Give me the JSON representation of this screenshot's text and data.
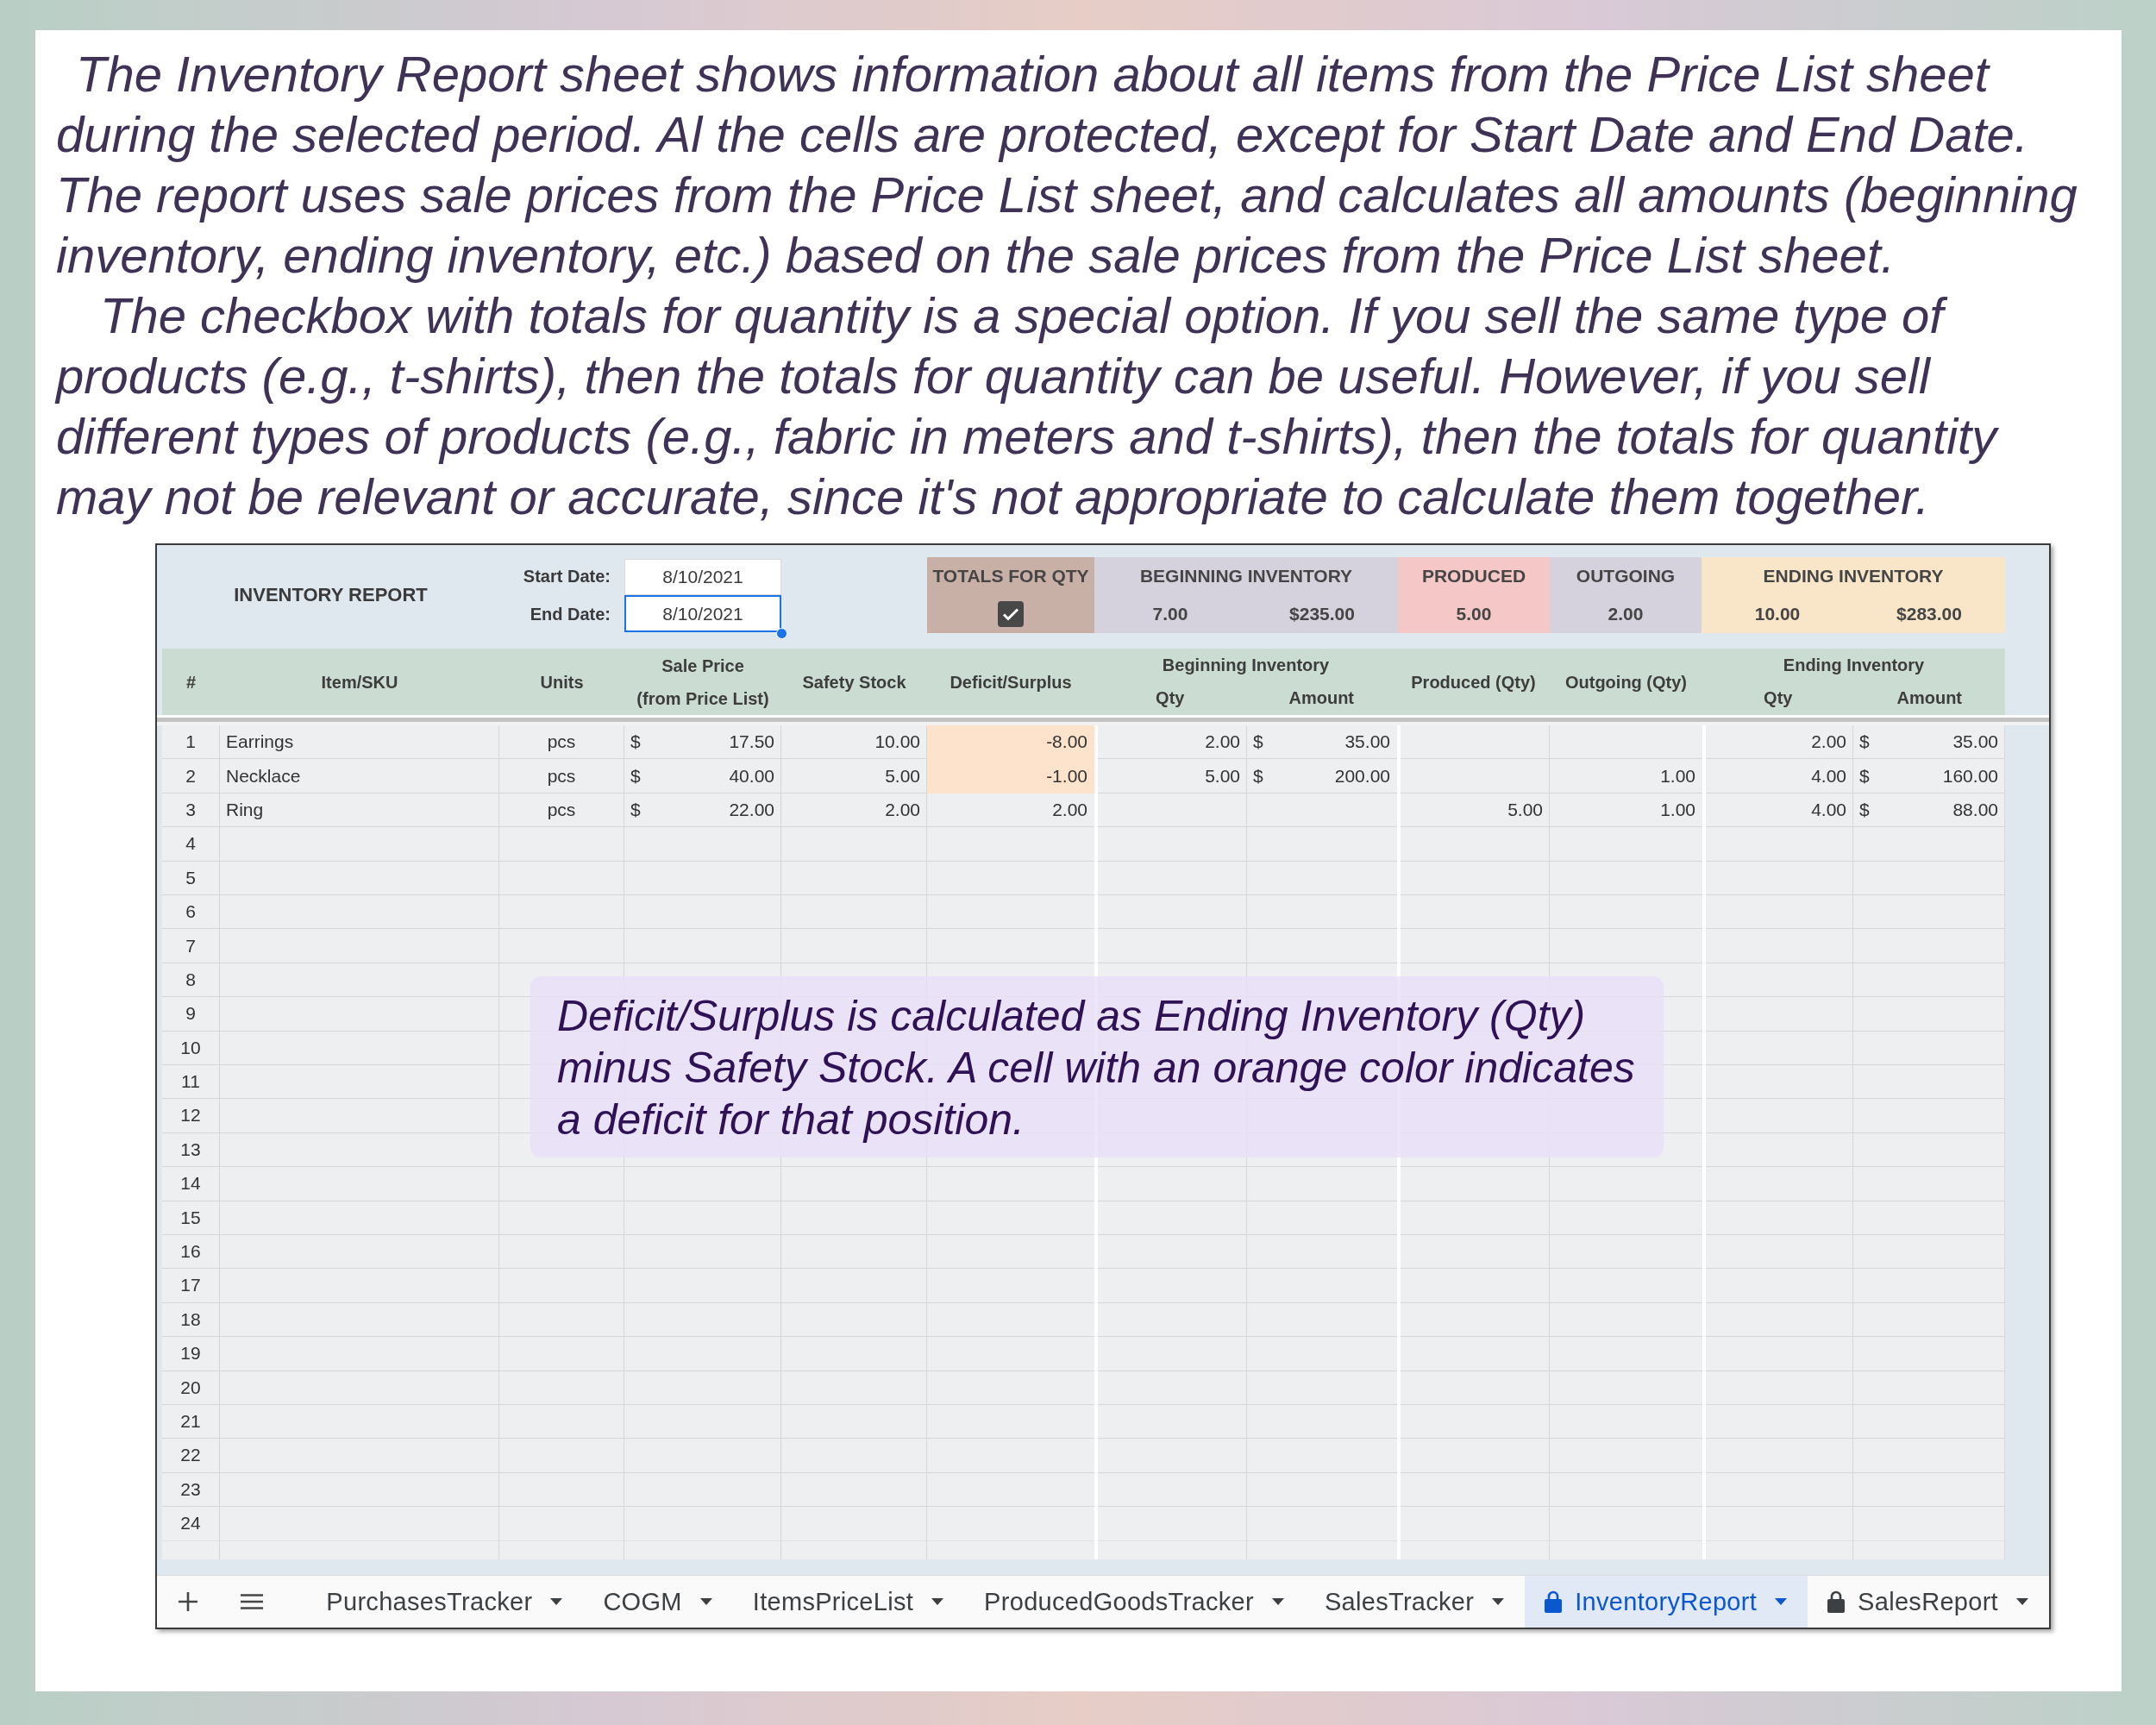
{
  "intro": {
    "paragraphs": [
      "The Inventory Report sheet shows information about all items from the Price List sheet during the selected period. Al the cells are protected, except for Start Date and End Date. The report uses sale prices from the Price List sheet, and calculates all amounts (beginning inventory, ending inventory, etc.) based on the sale prices from the Price List sheet.",
      "The checkbox with totals for quantity is a special option. If you sell the same type of products (e.g., t-shirts), then the totals for quantity can be useful. However, if you sell different types of products (e.g., fabric in meters and t-shirts), then the totals for quantity may not be relevant or accurate, since it's not appropriate to calculate them together."
    ]
  },
  "sheet": {
    "title": "INVENTORY REPORT",
    "dates": [
      {
        "label": "Start Date:",
        "value": "8/10/2021",
        "selected": false
      },
      {
        "label": "End Date:",
        "value": "8/10/2021",
        "selected": true
      }
    ],
    "totals_for_qty": {
      "label": "TOTALS FOR QTY",
      "checked": true,
      "color": "#c9b0a7"
    },
    "summary_blocks": [
      {
        "label": "BEGINNING INVENTORY",
        "values": [
          "7.00",
          "$235.00"
        ],
        "color": "#d5d2dd"
      },
      {
        "label": "PRODUCED",
        "values": [
          "5.00"
        ],
        "color": "#f5c7c7"
      },
      {
        "label": "OUTGOING",
        "values": [
          "2.00"
        ],
        "color": "#d5d2dd"
      },
      {
        "label": "ENDING INVENTORY",
        "values": [
          "10.00",
          "$283.00"
        ],
        "color": "#f9e6c9"
      }
    ],
    "columns": [
      {
        "kind": "single",
        "label": "#"
      },
      {
        "kind": "single",
        "label": "Item/SKU"
      },
      {
        "kind": "single",
        "label": "Units"
      },
      {
        "kind": "two-line",
        "label": "Sale Price",
        "sublabel": "(from Price List)"
      },
      {
        "kind": "single",
        "label": "Safety Stock"
      },
      {
        "kind": "single",
        "label": "Deficit/Surplus"
      },
      {
        "kind": "group",
        "label": "Beginning Inventory",
        "subcolumns": [
          "Qty",
          "Amount"
        ]
      },
      {
        "kind": "single",
        "label": "Produced (Qty)"
      },
      {
        "kind": "single",
        "label": "Outgoing (Qty)"
      },
      {
        "kind": "group",
        "label": "Ending Inventory",
        "subcolumns": [
          "Qty",
          "Amount"
        ]
      }
    ],
    "rows": [
      {
        "number": "1",
        "item": "Earrings",
        "units": "pcs",
        "sale_price": {
          "symbol": "$",
          "value": "17.50"
        },
        "safety_stock": "10.00",
        "deficit_surplus": {
          "value": "-8.00",
          "deficit": true
        },
        "beginning_qty": "2.00",
        "beginning_amount": {
          "symbol": "$",
          "value": "35.00"
        },
        "ending_qty": "2.00",
        "ending_amount": {
          "symbol": "$",
          "value": "35.00"
        }
      },
      {
        "number": "2",
        "item": "Necklace",
        "units": "pcs",
        "sale_price": {
          "symbol": "$",
          "value": "40.00"
        },
        "safety_stock": "5.00",
        "deficit_surplus": {
          "value": "-1.00",
          "deficit": true
        },
        "beginning_qty": "5.00",
        "beginning_amount": {
          "symbol": "$",
          "value": "200.00"
        },
        "outgoing_qty": "1.00",
        "ending_qty": "4.00",
        "ending_amount": {
          "symbol": "$",
          "value": "160.00"
        }
      },
      {
        "number": "3",
        "item": "Ring",
        "units": "pcs",
        "sale_price": {
          "symbol": "$",
          "value": "22.00"
        },
        "safety_stock": "2.00",
        "deficit_surplus": {
          "value": "2.00",
          "deficit": false
        },
        "produced_qty": "5.00",
        "outgoing_qty": "1.00",
        "ending_qty": "4.00",
        "ending_amount": {
          "symbol": "$",
          "value": "88.00"
        }
      },
      {
        "number": "4"
      },
      {
        "number": "5"
      },
      {
        "number": "6"
      },
      {
        "number": "7"
      },
      {
        "number": "8"
      },
      {
        "number": "9"
      },
      {
        "number": "10"
      },
      {
        "number": "11"
      },
      {
        "number": "12"
      },
      {
        "number": "13"
      },
      {
        "number": "14"
      },
      {
        "number": "15"
      },
      {
        "number": "16"
      },
      {
        "number": "17"
      },
      {
        "number": "18"
      },
      {
        "number": "19"
      },
      {
        "number": "20"
      },
      {
        "number": "21"
      },
      {
        "number": "22"
      },
      {
        "number": "23"
      },
      {
        "number": "24"
      }
    ]
  },
  "callout": {
    "text": "Deficit/Surplus is calculated as Ending Inventory (Qty) minus Safety Stock. A cell with an orange color indicates a deficit for that position."
  },
  "tabs": [
    {
      "label": "PurchasesTracker",
      "locked": false,
      "selected": false
    },
    {
      "label": "COGM",
      "locked": false,
      "selected": false
    },
    {
      "label": "ItemsPriceList",
      "locked": false,
      "selected": false
    },
    {
      "label": "ProducedGoodsTracker",
      "locked": false,
      "selected": false
    },
    {
      "label": "SalesTracker",
      "locked": false,
      "selected": false
    },
    {
      "label": "InventoryReport",
      "locked": true,
      "selected": true
    },
    {
      "label": "SalesReport",
      "locked": true,
      "selected": false
    }
  ]
}
